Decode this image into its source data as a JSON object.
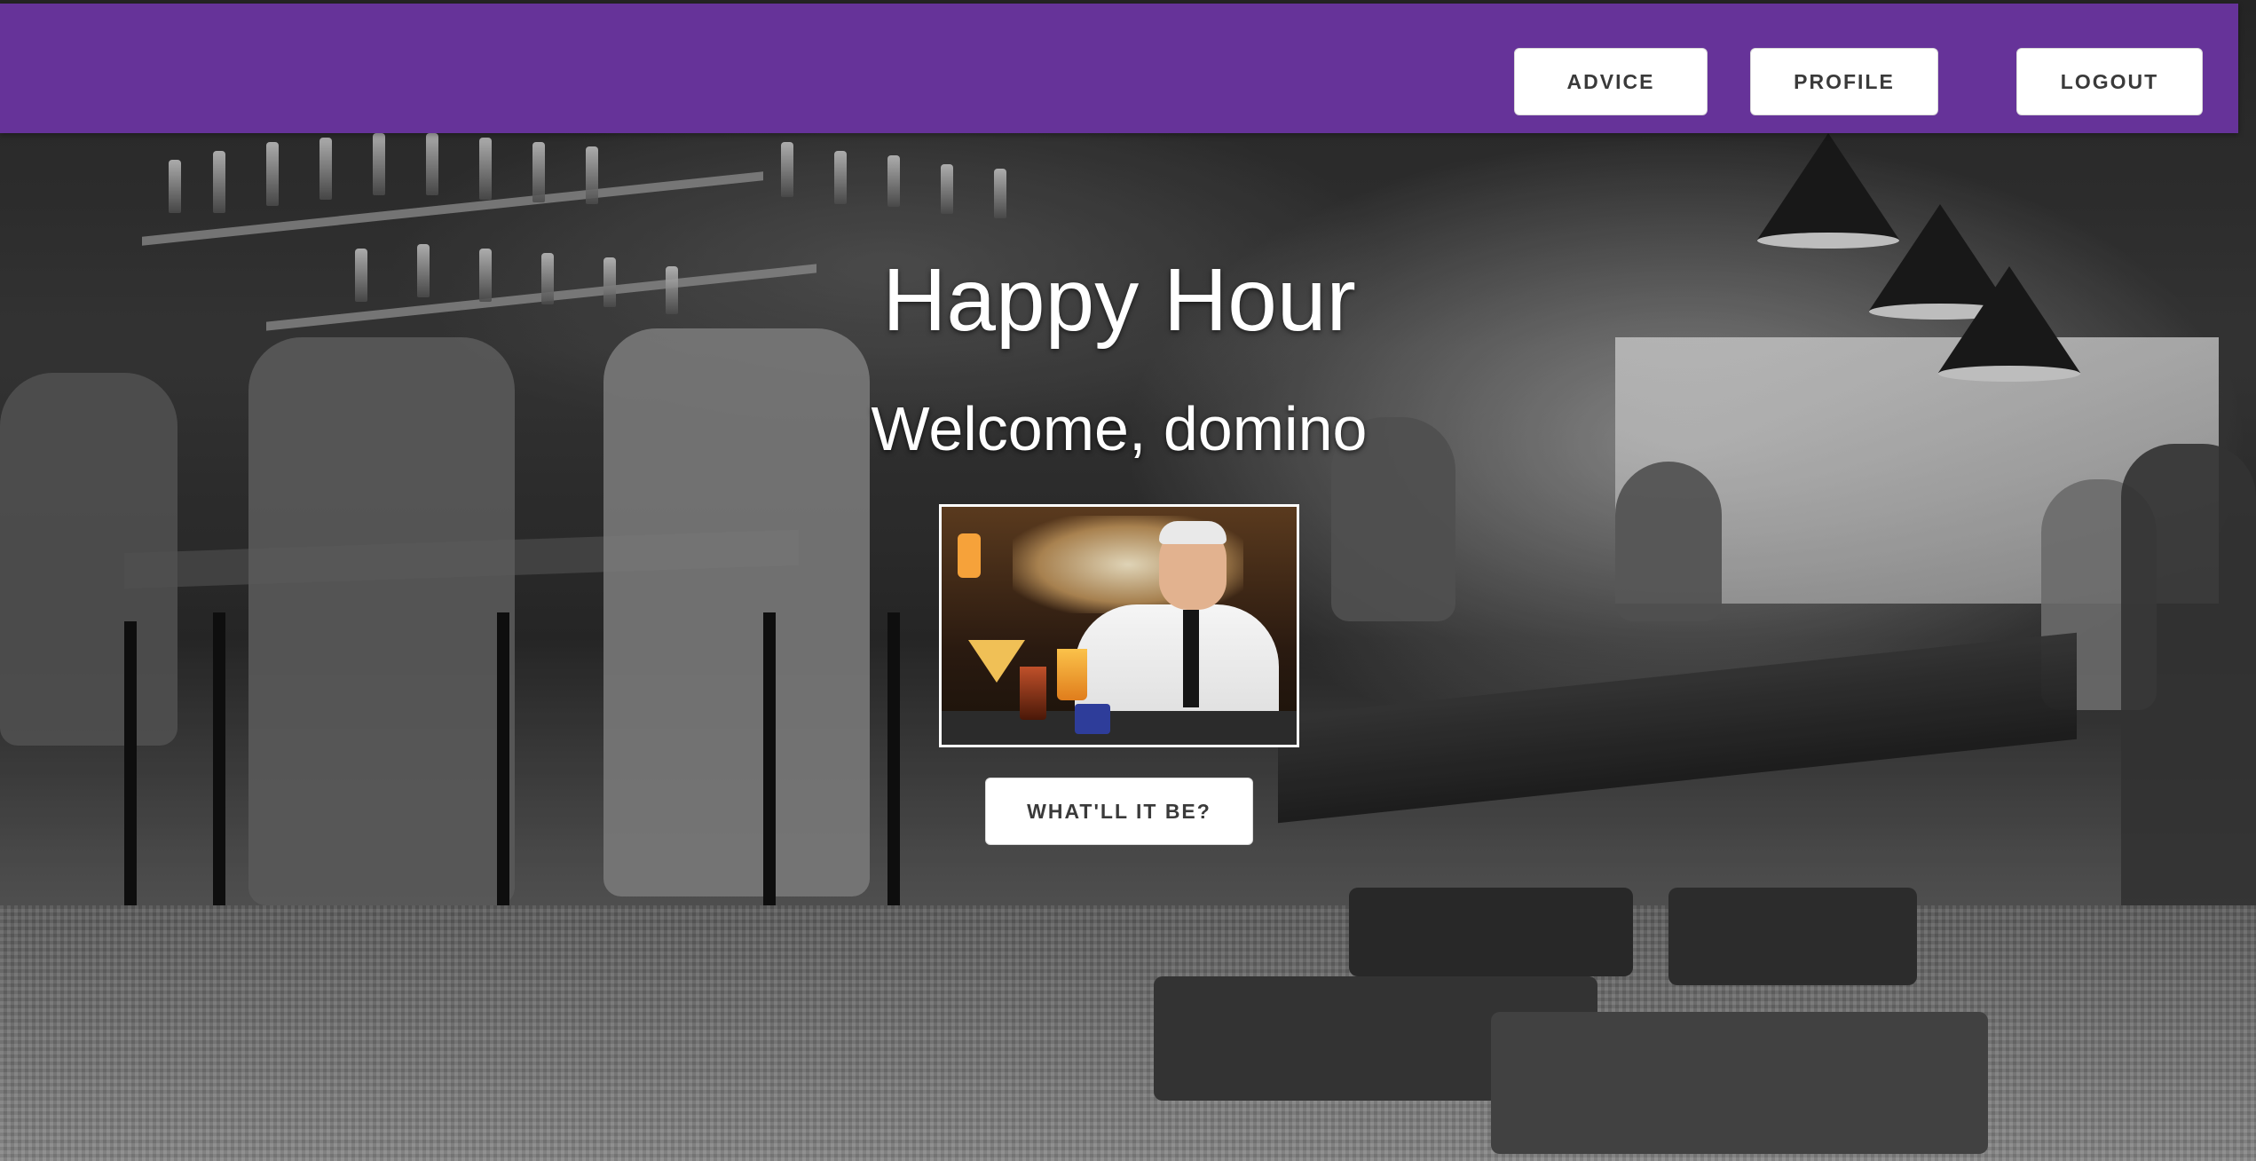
{
  "app": {
    "title": "Happy Hour"
  },
  "nav": {
    "buttons": [
      {
        "label": "ADVICE"
      },
      {
        "label": "PROFILE"
      },
      {
        "label": "LOGOUT"
      }
    ]
  },
  "hero": {
    "title": "Happy Hour",
    "welcome": "Welcome, domino",
    "photo_alt": "bartender",
    "cta_label": "WHAT'LL IT BE?"
  },
  "colors": {
    "navbar": "#663399",
    "button_bg": "#ffffff",
    "button_text": "#3a3a3a",
    "hero_text": "#ffffff"
  },
  "background": {
    "description_icon": "bar-background-image"
  }
}
